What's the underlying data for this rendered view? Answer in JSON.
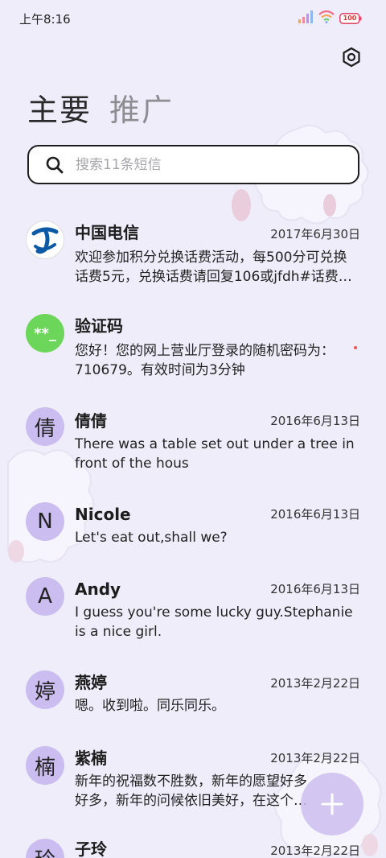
{
  "status_bar": {
    "time": "上午8:16",
    "battery": "100"
  },
  "tabs": [
    {
      "label": "主要"
    },
    {
      "label": "推广"
    }
  ],
  "search": {
    "placeholder": "搜索11条短信"
  },
  "messages": [
    {
      "sender": "中国电信",
      "date": "2017年6月30日",
      "snippet": "欢迎参加积分兑换话费活动，每500分可兑换话费5元，兑换话费请回复106或jfdh#话费…",
      "avatar": "telecom-logo"
    },
    {
      "sender": "验证码",
      "date": "",
      "snippet": "您好！您的网上营业厅登录的随机密码为：710679。有效时间为3分钟",
      "avatar": "**_"
    },
    {
      "sender": "倩倩",
      "date": "2016年6月13日",
      "snippet": "There was a table set out under a tree in front of the hous",
      "avatar": "倩"
    },
    {
      "sender": "Nicole",
      "date": "2016年6月13日",
      "snippet": "Let's eat out,shall we?",
      "avatar": "N"
    },
    {
      "sender": "Andy",
      "date": "2016年6月13日",
      "snippet": "I guess you're some lucky guy.Stephanie is a nice girl.",
      "avatar": "A"
    },
    {
      "sender": "燕婷",
      "date": "2013年2月22日",
      "snippet": "嗯。收到啦。同乐同乐。",
      "avatar": "婷"
    },
    {
      "sender": "紫楠",
      "date": "2013年2月22日",
      "snippet": "新年的祝福数不胜数，新年的愿望好多好多，新年的问候依旧美好，在这个温馨的",
      "avatar": "楠"
    },
    {
      "sender": "子玲",
      "date": "2013年2月22日",
      "snippet": "",
      "avatar": "玲"
    }
  ],
  "colors": {
    "background": "#efedf9",
    "avatar": "#cbbdf0",
    "verify_avatar": "#6cd65a",
    "telecom_blue": "#0c5aa6",
    "fab": "#cdbef0"
  },
  "icons": {
    "settings": "gear-icon",
    "search": "search-icon",
    "compose": "plus-icon",
    "signal": "signal-icon",
    "wifi": "wifi-icon",
    "battery": "battery-icon"
  }
}
